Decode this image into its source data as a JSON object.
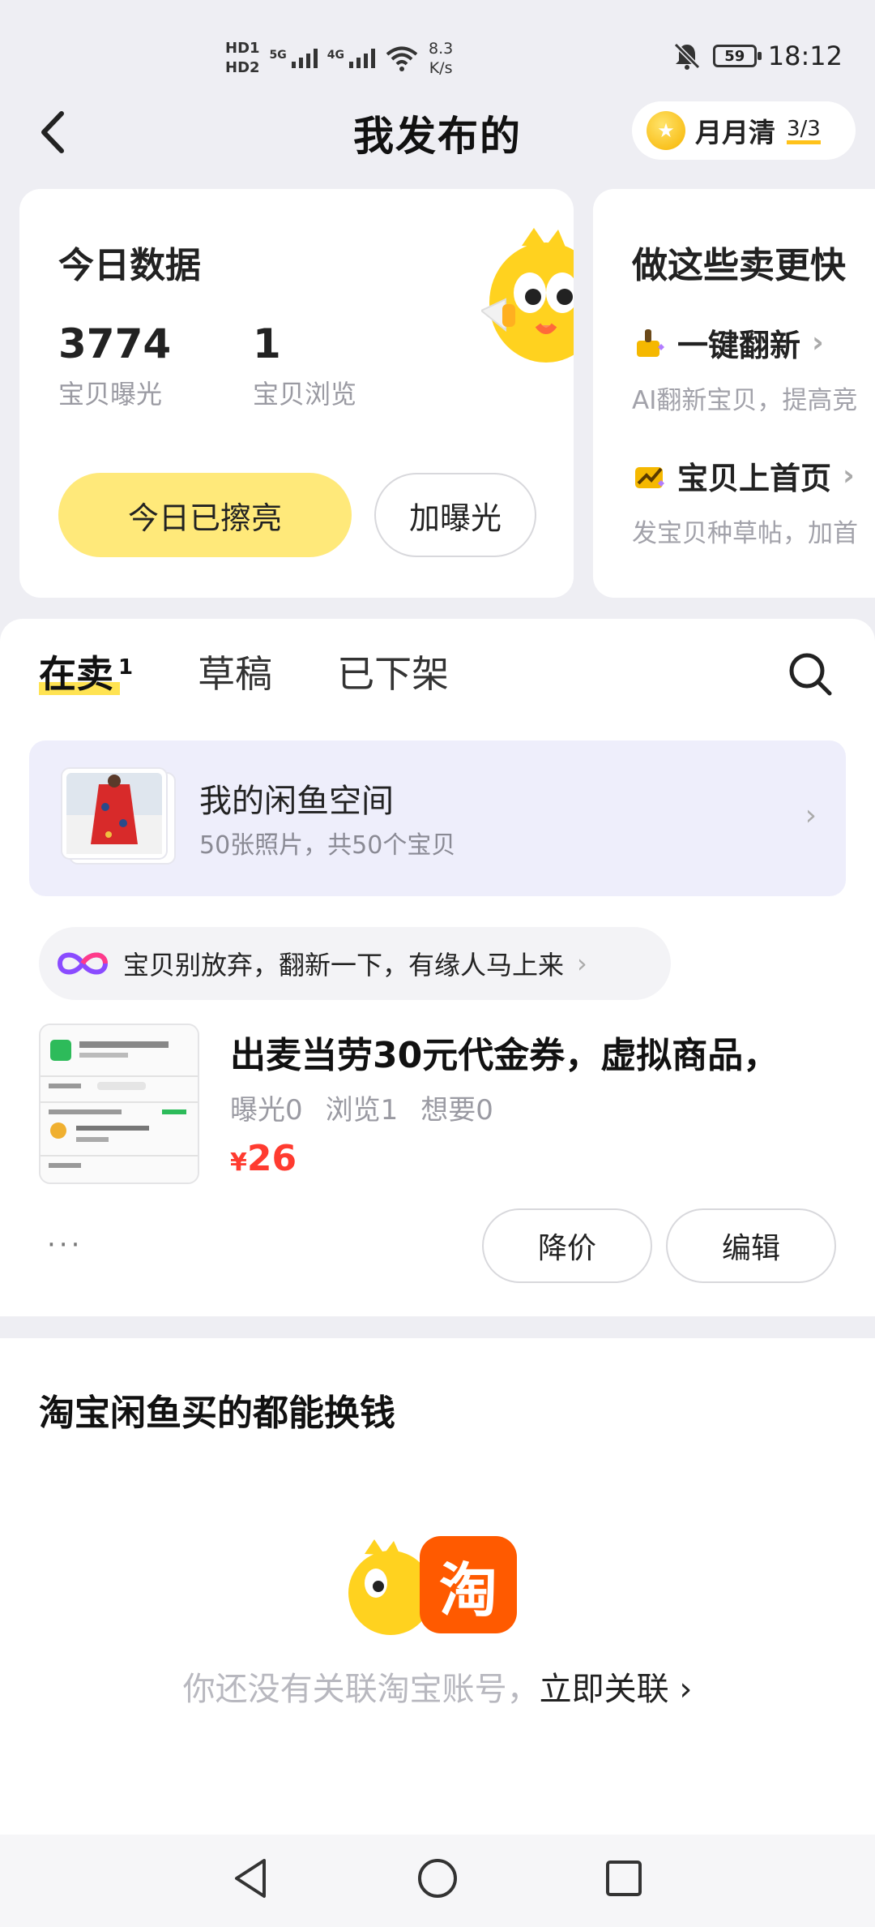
{
  "status_bar": {
    "hd1": "HD1",
    "hd2": "HD2",
    "net1": "5G",
    "net2": "4G",
    "speed_value": "8.3",
    "speed_unit": "K/s",
    "battery": "59",
    "time": "18:12"
  },
  "header": {
    "title": "我发布的",
    "pill_label": "月月清",
    "pill_count": "3/3"
  },
  "today_card": {
    "title": "今日数据",
    "stats": [
      {
        "value": "3774",
        "label": "宝贝曝光"
      },
      {
        "value": "1",
        "label": "宝贝浏览"
      }
    ],
    "primary_button": "今日已擦亮",
    "secondary_button": "加曝光"
  },
  "tips_card": {
    "title": "做这些卖更快",
    "items": [
      {
        "title": "一键翻新",
        "desc": "AI翻新宝贝，提高竞"
      },
      {
        "title": "宝贝上首页",
        "desc": "发宝贝种草帖，加首"
      }
    ]
  },
  "tabs": [
    {
      "label": "在卖",
      "badge": "1"
    },
    {
      "label": "草稿"
    },
    {
      "label": "已下架"
    }
  ],
  "space": {
    "title": "我的闲鱼空间",
    "subtitle": "50张照片，共50个宝贝"
  },
  "refresh_bar": {
    "text": "宝贝别放弃，翻新一下，有缘人马上来"
  },
  "item": {
    "title": "出麦当劳30元代金券，虚拟商品，",
    "stats": [
      "曝光0",
      "浏览1",
      "想要0"
    ],
    "currency": "¥",
    "price": "26",
    "more": "···",
    "actions": [
      "降价",
      "编辑"
    ]
  },
  "taobao": {
    "title": "淘宝闲鱼买的都能换钱",
    "logo_char": "淘",
    "prompt": "你还没有关联淘宝账号，",
    "link": "立即关联"
  },
  "colors": {
    "accent_yellow": "#ffe97a",
    "price_red": "#ff3b30",
    "taobao_orange": "#ff5a00"
  }
}
